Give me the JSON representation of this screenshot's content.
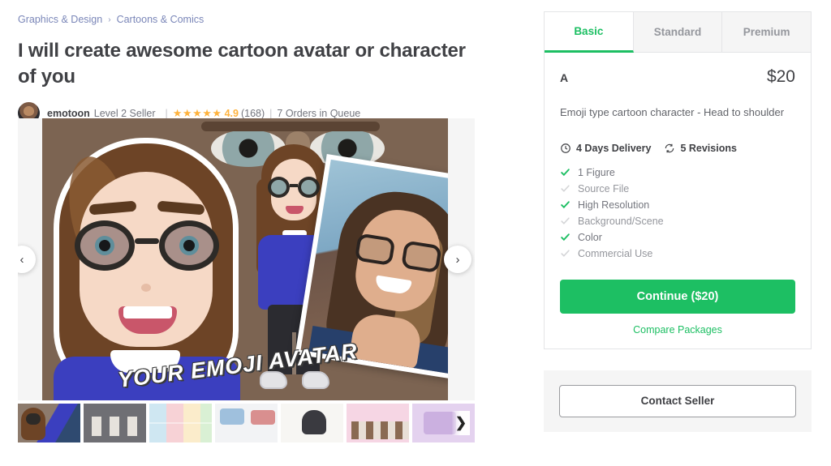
{
  "breadcrumb": {
    "items": [
      {
        "label": "Graphics & Design"
      },
      {
        "label": "Cartoons & Comics"
      }
    ],
    "separator": "›"
  },
  "gig": {
    "title": "I will create awesome cartoon avatar or character of you",
    "seller": {
      "name": "emotoon",
      "level": "Level 2 Seller",
      "stars": "★★★★★",
      "rating": "4.9",
      "reviews_count": "(168)",
      "orders_in_queue": "7 Orders in Queue",
      "separator": "|"
    }
  },
  "carousel": {
    "prev_icon": "‹",
    "next_icon": "›",
    "hero_banner_text": "YOUR EMOJI AVATAR",
    "thumbnails": [
      {
        "name": "thumb-1-avatar-trio",
        "selected": true
      },
      {
        "name": "thumb-2-packages-overview",
        "selected": false
      },
      {
        "name": "thumb-3-color-grid",
        "selected": false
      },
      {
        "name": "thumb-4-couple-scene",
        "selected": false
      },
      {
        "name": "thumb-5-single-character",
        "selected": false
      },
      {
        "name": "thumb-6-family-group",
        "selected": false
      },
      {
        "name": "thumb-7-pink-promo",
        "selected": false
      }
    ],
    "thumbs_next_icon": "❯"
  },
  "packages": {
    "tabs": [
      {
        "label": "Basic",
        "active": true
      },
      {
        "label": "Standard",
        "active": false
      },
      {
        "label": "Premium",
        "active": false
      }
    ],
    "selected": {
      "name": "A",
      "price": "$20",
      "description": "Emoji type cartoon character - Head to shoulder",
      "delivery": "4 Days Delivery",
      "revisions": "5 Revisions",
      "delivery_icon": "clock-icon",
      "revisions_icon": "refresh-icon",
      "features": [
        {
          "label": "1 Figure",
          "included": true
        },
        {
          "label": "Source File",
          "included": false
        },
        {
          "label": "High Resolution",
          "included": true
        },
        {
          "label": "Background/Scene",
          "included": false
        },
        {
          "label": "Color",
          "included": true
        },
        {
          "label": "Commercial Use",
          "included": false
        }
      ],
      "continue_label": "Continue ($20)",
      "compare_label": "Compare Packages"
    }
  },
  "contact": {
    "button_label": "Contact Seller"
  },
  "colors": {
    "brand_green": "#1dbf63",
    "star_orange": "#ffb33e",
    "link_blue": "#7a86b8",
    "text_dark": "#404145",
    "text_muted": "#74767e",
    "text_disabled": "#95979d"
  }
}
